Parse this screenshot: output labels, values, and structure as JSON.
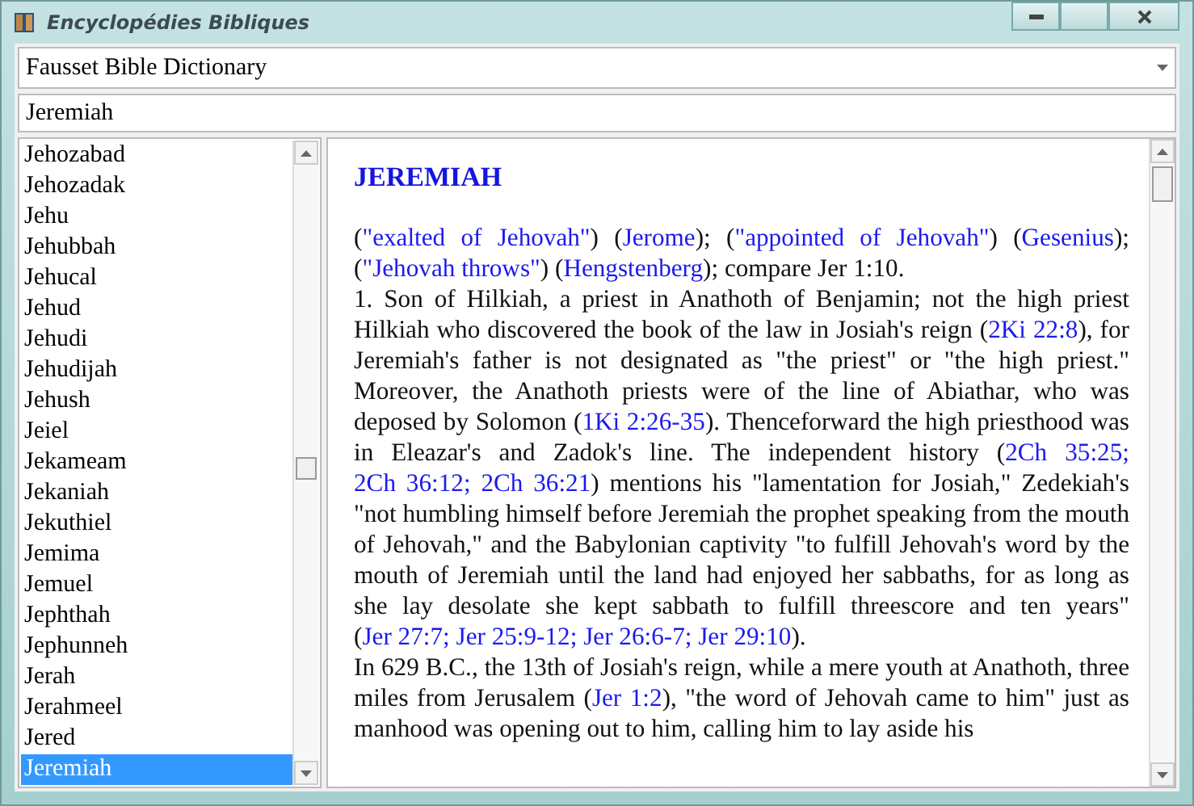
{
  "window": {
    "title": "Encyclopédies Bibliques"
  },
  "dictionary_select": {
    "value": "Fausset Bible Dictionary"
  },
  "search": {
    "value": "Jeremiah"
  },
  "entries": [
    {
      "label": "Jehozabad",
      "selected": false
    },
    {
      "label": "Jehozadak",
      "selected": false
    },
    {
      "label": "Jehu",
      "selected": false
    },
    {
      "label": "Jehubbah",
      "selected": false
    },
    {
      "label": "Jehucal",
      "selected": false
    },
    {
      "label": "Jehud",
      "selected": false
    },
    {
      "label": "Jehudi",
      "selected": false
    },
    {
      "label": "Jehudijah",
      "selected": false
    },
    {
      "label": "Jehush",
      "selected": false
    },
    {
      "label": "Jeiel",
      "selected": false
    },
    {
      "label": "Jekameam",
      "selected": false
    },
    {
      "label": "Jekaniah",
      "selected": false
    },
    {
      "label": "Jekuthiel",
      "selected": false
    },
    {
      "label": "Jemima",
      "selected": false
    },
    {
      "label": "Jemuel",
      "selected": false
    },
    {
      "label": "Jephthah",
      "selected": false
    },
    {
      "label": "Jephunneh",
      "selected": false
    },
    {
      "label": "Jerah",
      "selected": false
    },
    {
      "label": "Jerahmeel",
      "selected": false
    },
    {
      "label": "Jered",
      "selected": false
    },
    {
      "label": "Jeremiah",
      "selected": true
    }
  ],
  "article": {
    "heading": "JEREMIAH",
    "paragraphs": [
      [
        {
          "kind": "text",
          "text": "("
        },
        {
          "kind": "link",
          "text": "\"exalted of Jehovah\""
        },
        {
          "kind": "text",
          "text": ") ("
        },
        {
          "kind": "link",
          "text": "Jerome"
        },
        {
          "kind": "text",
          "text": "); ("
        },
        {
          "kind": "link",
          "text": "\"appointed of Jehovah\""
        },
        {
          "kind": "text",
          "text": ") ("
        },
        {
          "kind": "link",
          "text": "Gesenius"
        },
        {
          "kind": "text",
          "text": "); ("
        },
        {
          "kind": "link",
          "text": "\"Jehovah throws\""
        },
        {
          "kind": "text",
          "text": ") ("
        },
        {
          "kind": "link",
          "text": "Hengstenberg"
        },
        {
          "kind": "text",
          "text": "); compare Jer 1:10."
        }
      ],
      [
        {
          "kind": "text",
          "text": "1. Son of Hilkiah, a priest in Anathoth of Benjamin; not the high priest Hilkiah who discovered the book of the law in Josiah's reign ("
        },
        {
          "kind": "link",
          "text": "2Ki 22:8"
        },
        {
          "kind": "text",
          "text": "), for Jeremiah's father is not designated as \"the priest\" or \"the high priest.\" Moreover, the Anathoth priests were of the line of Abiathar, who was deposed by Solomon ("
        },
        {
          "kind": "link",
          "text": "1Ki 2:26-35"
        },
        {
          "kind": "text",
          "text": "). Thenceforward the high priesthood was in Eleazar's and Zadok's line. The independent history ("
        },
        {
          "kind": "link",
          "text": "2Ch 35:25"
        },
        {
          "kind": "sep",
          "text": "; "
        },
        {
          "kind": "link",
          "text": "2Ch 36:12"
        },
        {
          "kind": "sep",
          "text": "; "
        },
        {
          "kind": "link",
          "text": "2Ch 36:21"
        },
        {
          "kind": "text",
          "text": ") mentions his \"lamentation for Josiah,\" Zedekiah's \"not humbling himself before Jeremiah the prophet speaking from the mouth of Jehovah,\" and the Babylonian captivity \"to fulfill Jehovah's word by the mouth of Jeremiah until the land had enjoyed her sabbaths, for as long as she lay desolate she kept sabbath to fulfill threescore and ten years\" ("
        },
        {
          "kind": "link",
          "text": "Jer 27:7"
        },
        {
          "kind": "sep",
          "text": "; "
        },
        {
          "kind": "link",
          "text": "Jer 25:9-12"
        },
        {
          "kind": "sep",
          "text": "; "
        },
        {
          "kind": "link",
          "text": "Jer 26:6-7"
        },
        {
          "kind": "sep",
          "text": "; "
        },
        {
          "kind": "link",
          "text": "Jer 29:10"
        },
        {
          "kind": "text",
          "text": ")."
        }
      ],
      [
        {
          "kind": "text",
          "text": "In 629 B.C., the 13th of Josiah's reign, while a mere youth at Anathoth, three miles from Jerusalem ("
        },
        {
          "kind": "link",
          "text": "Jer 1:2"
        },
        {
          "kind": "text",
          "text": "), \"the word of Jehovah came to him\" just as manhood was opening out to him, calling him to lay aside his"
        }
      ]
    ]
  }
}
